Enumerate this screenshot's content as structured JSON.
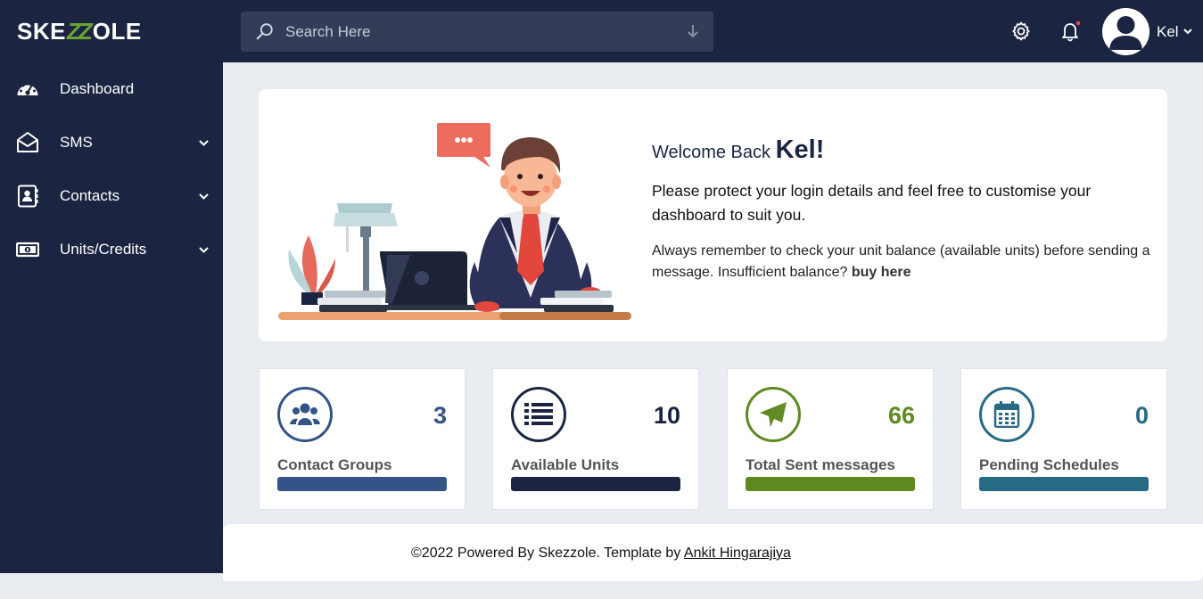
{
  "brand": {
    "logo_left": "SKE",
    "logo_mid": "ZZ",
    "logo_right": "OLE"
  },
  "colors": {
    "navy": "#1b2542",
    "blue": "#345488",
    "dark": "#1b2542",
    "green": "#5e8a21",
    "teal": "#276a84"
  },
  "search": {
    "placeholder": "Search Here"
  },
  "header": {
    "username": "Kel",
    "icons": [
      "search-icon",
      "download-arrow-icon",
      "gear-icon",
      "bell-icon",
      "avatar-icon",
      "chevron-down-icon"
    ]
  },
  "sidebar": {
    "items": [
      {
        "label": "Dashboard",
        "icon": "speedometer-icon",
        "has_submenu": false
      },
      {
        "label": "SMS",
        "icon": "envelope-open-icon",
        "has_submenu": true
      },
      {
        "label": "Contacts",
        "icon": "address-book-icon",
        "has_submenu": true
      },
      {
        "label": "Units/Credits",
        "icon": "money-bill-icon",
        "has_submenu": true
      }
    ]
  },
  "welcome": {
    "greeting": "Welcome Back",
    "name": "Kel!",
    "message": "Please protect your login details and feel free to customise your dashboard to suit you.",
    "note": "Always remember to check your unit balance (available units) before sending a message. Insufficient balance?",
    "link": "buy here",
    "bubble": "•••"
  },
  "stats": [
    {
      "label": "Contact Groups",
      "value": "3",
      "icon": "users-icon",
      "color": "#345488"
    },
    {
      "label": "Available Units",
      "value": "10",
      "icon": "list-icon",
      "color": "#1b2542"
    },
    {
      "label": "Total Sent messages",
      "value": "66",
      "icon": "paper-plane-icon",
      "color": "#5e8a21"
    },
    {
      "label": "Pending Schedules",
      "value": "0",
      "icon": "calendar-icon",
      "color": "#276a84"
    }
  ],
  "footer": {
    "text": "©2022 Powered By Skezzole. Template by",
    "link": "Ankit Hingarajiya"
  }
}
